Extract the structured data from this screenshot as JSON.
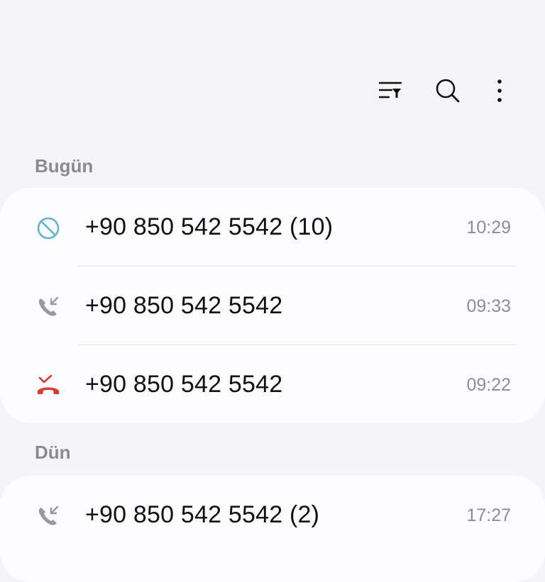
{
  "toolbar": {
    "icons": [
      "filter-icon",
      "search-icon",
      "more-vert-icon"
    ]
  },
  "sections": {
    "today": {
      "title": "Bugün",
      "rows": [
        {
          "icon": "blocked-call-icon",
          "number": "+90 850 542 5542 (10)",
          "time": "10:29"
        },
        {
          "icon": "incoming-call-icon",
          "number": "+90 850 542 5542",
          "time": "09:33"
        },
        {
          "icon": "missed-call-icon",
          "number": "+90 850 542 5542",
          "time": "09:22"
        }
      ]
    },
    "yesterday": {
      "title": "Dün",
      "rows": [
        {
          "icon": "incoming-call-icon",
          "number": "+90 850 542 5542 (2)",
          "time": "17:27"
        }
      ]
    }
  },
  "colors": {
    "background": "#f5f5f7",
    "card": "#fdfdff",
    "blocked": "#5fb3d6",
    "missed": "#d93a32",
    "incoming": "#9a9a9e",
    "header": "#8b8b8e",
    "time": "#8e8e92"
  }
}
